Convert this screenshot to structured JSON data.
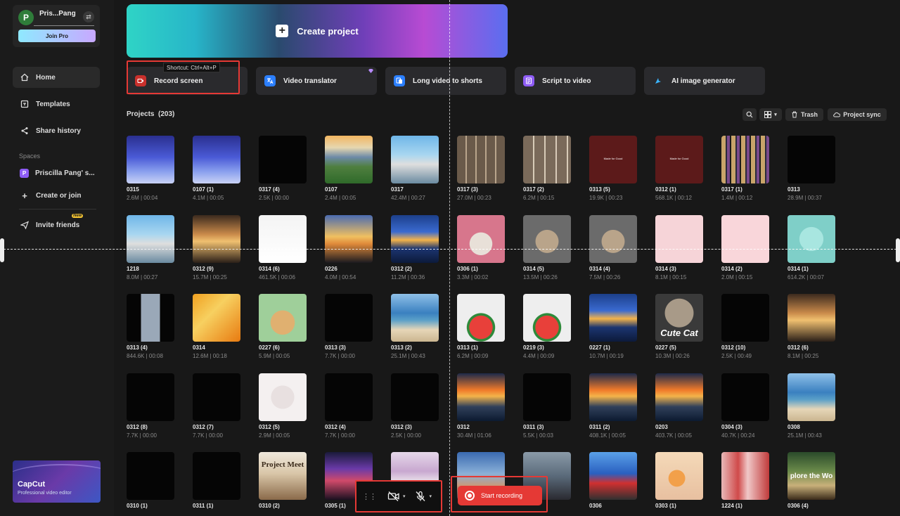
{
  "user": {
    "name": "Pris...Pang",
    "avatar_letter": "P",
    "join_pro": "Join Pro"
  },
  "nav": [
    {
      "label": "Home",
      "icon": "home-icon",
      "active": true
    },
    {
      "label": "Templates",
      "icon": "templates-icon"
    },
    {
      "label": "Share history",
      "icon": "share-icon"
    }
  ],
  "spaces": {
    "label": "Spaces",
    "space_name": "Priscilla Pang' s...",
    "space_letter": "P",
    "create_join": "Create or join"
  },
  "invite": {
    "label": "Invite friends",
    "badge": "New"
  },
  "promo": {
    "title": "CapCut",
    "subtitle": "Professional video editor"
  },
  "create_project": "Create project",
  "tools": [
    {
      "label": "Record screen",
      "icon": "record-icon",
      "color": "#e53935"
    },
    {
      "label": "Video translator",
      "icon": "translate-icon",
      "color": "#2b7fff",
      "pro": true
    },
    {
      "label": "Long video to shorts",
      "icon": "shorts-icon",
      "color": "#2b7fff"
    },
    {
      "label": "Script to video",
      "icon": "script-icon",
      "color": "#8e5cf5"
    },
    {
      "label": "AI image generator",
      "icon": "ai-image-icon",
      "color": "#3bb5ff"
    }
  ],
  "tooltip": "Shortcut: Ctrl+Alt+P",
  "projects": {
    "label": "Projects",
    "count": "(203)",
    "trash": "Trash",
    "sync": "Project sync"
  },
  "rows": [
    [
      {
        "name": "0315",
        "meta": "2.6M | 00:04",
        "t": "blue"
      },
      {
        "name": "0107 (1)",
        "meta": "4.1M | 00:05",
        "t": "blue"
      },
      {
        "name": "0317 (4)",
        "meta": "2.5K | 00:00",
        "t": "black"
      },
      {
        "name": "0107",
        "meta": "2.4M | 00:05",
        "t": "mountain"
      },
      {
        "name": "0317",
        "meta": "42.4M | 00:27",
        "t": "bus"
      },
      {
        "name": "0317 (3)",
        "meta": "27.0M | 00:23",
        "t": "grid"
      },
      {
        "name": "0317 (2)",
        "meta": "6.2M | 00:15",
        "t": "grid2"
      },
      {
        "name": "0313 (5)",
        "meta": "19.9K | 00:23",
        "t": "maroon",
        "txt": "Made for Good"
      },
      {
        "name": "0312 (1)",
        "meta": "568.1K | 00:12",
        "t": "maroon",
        "txt": "Made for Good"
      },
      {
        "name": "0317 (1)",
        "meta": "1.4M | 00:12",
        "t": "mosaic"
      },
      {
        "name": "0313",
        "meta": "28.9M | 00:37",
        "t": "black"
      }
    ],
    [
      {
        "name": "1218",
        "meta": "8.0M | 00:27",
        "t": "bus"
      },
      {
        "name": "0312 (9)",
        "meta": "15.7M | 00:25",
        "t": "sunset-people"
      },
      {
        "name": "0314 (6)",
        "meta": "461.5K | 00:06",
        "t": "doc"
      },
      {
        "name": "0226",
        "meta": "4.0M | 00:54",
        "t": "sunset-people2"
      },
      {
        "name": "0312 (2)",
        "meta": "11.2M | 00:36",
        "t": "sea-sunset"
      },
      {
        "name": "0306 (1)",
        "meta": "3.3M | 00:02",
        "t": "cat-pink"
      },
      {
        "name": "0314 (5)",
        "meta": "13.5M | 00:26",
        "t": "cat"
      },
      {
        "name": "0314 (4)",
        "meta": "7.5M | 00:26",
        "t": "cat"
      },
      {
        "name": "0314 (3)",
        "meta": "8.1M | 00:15",
        "t": "pink"
      },
      {
        "name": "0314 (2)",
        "meta": "2.0M | 00:15",
        "t": "envelope"
      },
      {
        "name": "0314 (1)",
        "meta": "614.2K | 00:07",
        "t": "teal"
      }
    ],
    [
      {
        "name": "0313 (4)",
        "meta": "844.6K | 00:08",
        "t": "strip"
      },
      {
        "name": "0314",
        "meta": "12.6M | 00:18",
        "t": "autumn"
      },
      {
        "name": "0227 (6)",
        "meta": "5.9M | 00:05",
        "t": "cat-green"
      },
      {
        "name": "0313 (3)",
        "meta": "7.7K | 00:00",
        "t": "black"
      },
      {
        "name": "0313 (2)",
        "meta": "25.1M | 00:43",
        "t": "beach"
      },
      {
        "name": "0313 (1)",
        "meta": "6.2M | 00:09",
        "t": "watermelon"
      },
      {
        "name": "0219 (3)",
        "meta": "4.4M | 00:09",
        "t": "watermelon"
      },
      {
        "name": "0227 (1)",
        "meta": "10.7M | 00:19",
        "t": "sea-sunset"
      },
      {
        "name": "0227 (5)",
        "meta": "10.3M | 00:26",
        "t": "cutecat",
        "txt": "Cute Cat"
      },
      {
        "name": "0312 (10)",
        "meta": "2.5K | 00:49",
        "t": "black"
      },
      {
        "name": "0312 (6)",
        "meta": "8.1M | 00:25",
        "t": "sunset-people"
      }
    ],
    [
      {
        "name": "0312 (8)",
        "meta": "7.7K | 00:00",
        "t": "black"
      },
      {
        "name": "0312 (7)",
        "meta": "7.7K | 00:00",
        "t": "black"
      },
      {
        "name": "0312 (5)",
        "meta": "2.9M | 00:05",
        "t": "cat-red"
      },
      {
        "name": "0312 (4)",
        "meta": "7.7K | 00:00",
        "t": "black"
      },
      {
        "name": "0312 (3)",
        "meta": "2.5K | 00:00",
        "t": "black"
      },
      {
        "name": "0312",
        "meta": "30.4M | 01:06",
        "t": "clouds-sunset"
      },
      {
        "name": "0311 (3)",
        "meta": "5.5K | 00:03",
        "t": "black"
      },
      {
        "name": "0311 (2)",
        "meta": "408.1K | 00:05",
        "t": "clouds-sunset"
      },
      {
        "name": "0203",
        "meta": "403.7K | 00:05",
        "t": "clouds-sunset"
      },
      {
        "name": "0304 (3)",
        "meta": "40.7K | 00:24",
        "t": "black"
      },
      {
        "name": "0308",
        "meta": "25.1M | 00:43",
        "t": "beach"
      }
    ],
    [
      {
        "name": "0310 (1)",
        "meta": "",
        "t": "black"
      },
      {
        "name": "0311 (1)",
        "meta": "",
        "t": "black"
      },
      {
        "name": "0310 (2)",
        "meta": "",
        "t": "classroom",
        "txt": "Project Meet"
      },
      {
        "name": "0305 (1)",
        "meta": "",
        "t": "concert"
      },
      {
        "name": "",
        "meta": "",
        "t": "lavender"
      },
      {
        "name": "",
        "meta": "",
        "t": "people-blue"
      },
      {
        "name": "",
        "meta": "",
        "t": "street"
      },
      {
        "name": "0306",
        "meta": "",
        "t": "food-truck"
      },
      {
        "name": "0303 (1)",
        "meta": "",
        "t": "flowers"
      },
      {
        "name": "1224 (1)",
        "meta": "",
        "t": "bottles"
      },
      {
        "name": "0306 (4)",
        "meta": "",
        "t": "forest",
        "txt": "plore the Wo"
      }
    ]
  ],
  "recording": {
    "start": "Start recording"
  }
}
